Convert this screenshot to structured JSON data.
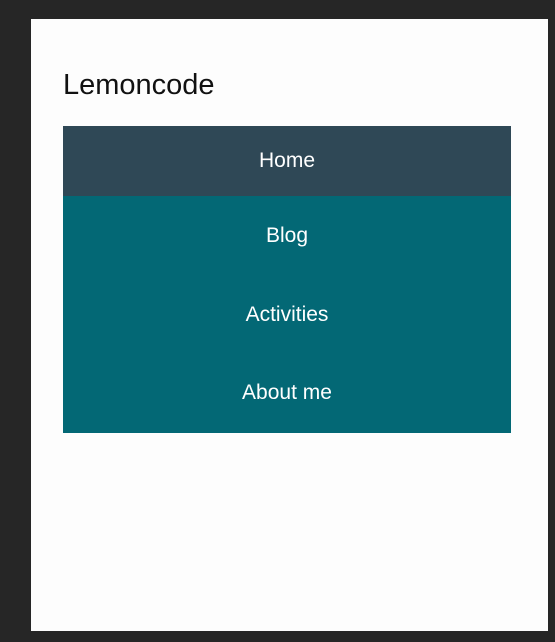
{
  "header": {
    "title": "Lemoncode"
  },
  "menu": {
    "items": [
      {
        "label": "Home",
        "active": true
      },
      {
        "label": "Blog",
        "active": false
      },
      {
        "label": "Activities",
        "active": false
      },
      {
        "label": "About me",
        "active": false
      }
    ]
  },
  "colors": {
    "menu_background": "#036875",
    "menu_active_background": "#2f4856",
    "menu_text": "#ffffff",
    "page_background": "#fdfdfd",
    "frame_background": "#262626"
  }
}
